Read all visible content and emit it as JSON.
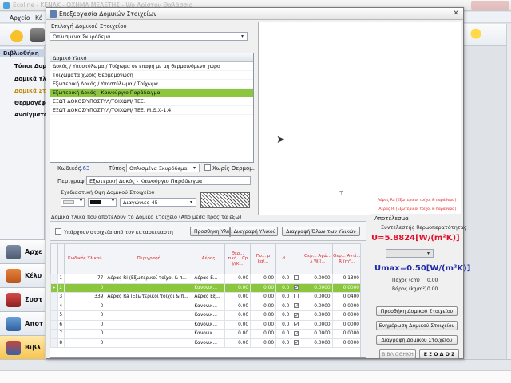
{
  "app": {
    "title": "Ecoline - KENAK - ΟΧΗΜΑ ΜΕΛΕΤΗΣ - Wo Αρίστου Θαλάσσιο",
    "menu": [
      "Αρχείο",
      "Κέ"
    ]
  },
  "sidebar": {
    "header": "Βιβλιοθήκη",
    "items": [
      {
        "label": "Τύποι Δομι"
      },
      {
        "label": "Δομικά Υλι"
      },
      {
        "label": "Δομικά Στο"
      },
      {
        "label": "Θερμογέφ"
      },
      {
        "label": "Ανοίγματα"
      }
    ],
    "modules": [
      {
        "label": "Αρχε",
        "icon": "archive-icon"
      },
      {
        "label": "Κέλυ",
        "icon": "house-icon"
      },
      {
        "label": "Συστ",
        "icon": "systems-icon"
      },
      {
        "label": "Αποτ",
        "icon": "results-icon"
      },
      {
        "label": "Βιβλ",
        "icon": "books-icon"
      }
    ]
  },
  "dialog": {
    "title": "Επεξεργασία Δομικών Στοιχείων",
    "selection_label": "Επιλογή Δομικού Στοιχείου",
    "selection_value": "Οπλισμένα Σκυρόδεμα",
    "list_header": "Δομικό Υλικό",
    "list_items": [
      "Δοκός / Υποστύλωμα / Τοίχωμα σε επαφή με μη θερμαινόμενο χώρο",
      "Τοιχώματα χωρίς Θερμομόνωση",
      "Εξωτερική Δοκός / Υποστύλωμα / Τοίχωμα",
      "Εξωτερική Δοκός - Καινούργιο Παράδειγμα",
      "ΕΞΩΤ ΔΟΚΟΣ/ΥΠΟΣΤΥΛ/ΤΟΙΧΩΜ/ ΤΕΕ.",
      "ΕΞΩΤ ΔΟΚΟΣ/ΥΠΟΣΤΥΛ/ΤΟΙΧΩΜ/ ΤΕΕ. Μ.Θ.Χ-1.4"
    ],
    "selected_index": 3,
    "code_label": "Κωδικός",
    "code_value": "163",
    "type_label": "Τύπος",
    "type_value": "Οπλισμένα Σκυρόδεμα",
    "no_insulation_label": "Χωρίς Θερμομ.",
    "description_label": "Περιγραφή",
    "description_value": "Εξωτερική Δοκός - Καινούργιο Παράδειγμα",
    "drawing_label": "Σχεδιαστική Οψη Δομικού Στοιχείου",
    "hatch_value": "Διαγώνιες 45",
    "preview_legend": [
      "Αέρας Ra [Εξωτερικοί τοίχοι & παράθυρα]",
      "Αέρας Ri [Εξωτερικοί τοίχοι & παράθυρα]"
    ],
    "preview_glyph": "⌶",
    "layers_title": "Δομικά Υλικά που αποτελούν το Δομικό Στοιχείο (Από μέσα προς τα έξω)",
    "has_data_label": "Υπάρχουν στοιχεία από τον κατασκευαστή",
    "add_material_btn": "Προσθήκη Υλικού",
    "delete_material_btn": "Διαγραφή Υλικού",
    "delete_all_btn": "Διαγραφή Όλων των Υλικών",
    "grid_headers": [
      "",
      "Κωδικός Υλικού",
      "Περιγραφή",
      "Αέρας",
      "Θερ... τικό... Cp J/(K...",
      "Πυ... ρ kg/...",
      "... d ...",
      "",
      "Θερ... Αγώ... λ W/(...",
      "Θερ... Αντί... R (m²..."
    ],
    "grid_rows": [
      {
        "n": "1",
        "code": "77",
        "desc": "Αέρας Ri (Εξωτερικοί τοίχοι & π...",
        "air": "Αέρας Ε...",
        "cp": "0.00",
        "rho": "0.00",
        "d": "0.0",
        "chk": "",
        "lam": "0.0000",
        "r": "0.1300"
      },
      {
        "n": "2",
        "code": "0",
        "desc": "",
        "air": "Κανονικ...",
        "cp": "0.00",
        "rho": "0.00",
        "d": "0.0",
        "chk": "✓",
        "lam": "0.0000",
        "r": "0.0000"
      },
      {
        "n": "3",
        "code": "339",
        "desc": "Αέρας Ra (Εξωτερικοί τοίχοι & π...",
        "air": "Αέρας Εξ...",
        "cp": "0.00",
        "rho": "0.00",
        "d": "0.0",
        "chk": "",
        "lam": "0.0000",
        "r": "0.0400"
      },
      {
        "n": "4",
        "code": "0",
        "desc": "",
        "air": "Κανονικ...",
        "cp": "0.00",
        "rho": "0.00",
        "d": "0.0",
        "chk": "✓",
        "lam": "0.0000",
        "r": "0.0000"
      },
      {
        "n": "5",
        "code": "0",
        "desc": "",
        "air": "Κανονικ...",
        "cp": "0.00",
        "rho": "0.00",
        "d": "0.0",
        "chk": "✓",
        "lam": "0.0000",
        "r": "0.0000"
      },
      {
        "n": "6",
        "code": "0",
        "desc": "",
        "air": "Κανονικ...",
        "cp": "0.00",
        "rho": "0.00",
        "d": "0.0",
        "chk": "✓",
        "lam": "0.0000",
        "r": "0.0000"
      },
      {
        "n": "7",
        "code": "0",
        "desc": "",
        "air": "Κανονικ...",
        "cp": "0.00",
        "rho": "0.00",
        "d": "0.0",
        "chk": "✓",
        "lam": "0.0000",
        "r": "0.0000"
      },
      {
        "n": "8",
        "code": "0",
        "desc": "",
        "air": "Κανονικ...",
        "cp": "0.00",
        "rho": "0.00",
        "d": "0.0",
        "chk": "✓",
        "lam": "0.0000",
        "r": "0.0000"
      }
    ],
    "selected_row": 1,
    "result": {
      "title": "Αποτέλεσμα",
      "coef_label": "Συντελεστής θερμοπερατότητας",
      "u_value": "U=5.8824[W/(m²K)]",
      "umax_value": "Umax=0.50[W/(m²K)]",
      "thickness_label": "Πάχος (cm)",
      "thickness_value": "0.00",
      "weight_label": "Βάρος (kg/m²)",
      "weight_value": "0.00",
      "add_btn": "Προσθήκη Δομικού Στοιχείου",
      "update_btn": "Ενημέρωση Δομικού Στοιχείου",
      "delete_btn": "Διαγραφή Δομικού Στοιχείου",
      "library_btn": "ΒΙΒΛΙΟΘΗΚΗ",
      "exit_btn": "Ε Ξ Ο Δ Ο Σ"
    }
  },
  "colors": {
    "selection_green": "#8cc63f",
    "u_red": "#e0102a",
    "umax_blue": "#1d2aa8"
  }
}
